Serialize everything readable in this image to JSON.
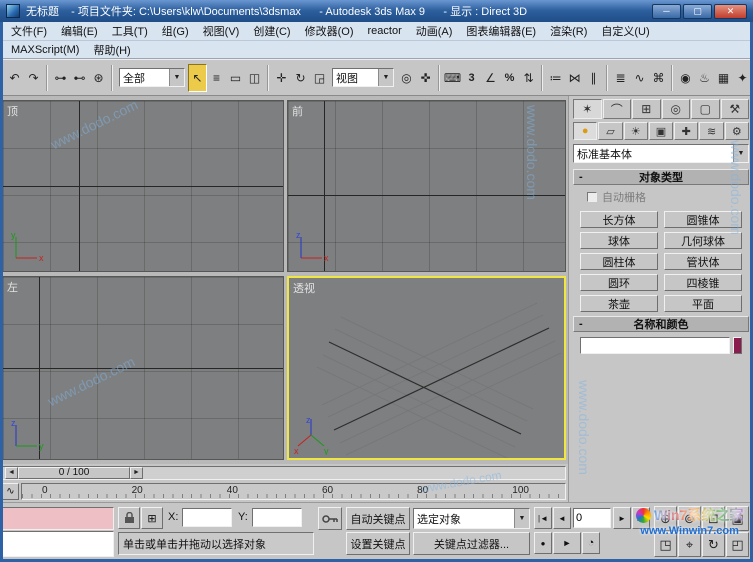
{
  "titlebar": {
    "doc": "无标题",
    "rest": "  - 项目文件夹: C:\\Users\\klw\\Documents\\3dsmax      - Autodesk 3ds Max 9      - 显示 : Direct 3D"
  },
  "menu": {
    "items": [
      "文件(F)",
      "编辑(E)",
      "工具(T)",
      "组(G)",
      "视图(V)",
      "创建(C)",
      "修改器(O)",
      "reactor",
      "动画(A)",
      "图表编辑器(E)",
      "渲染(R)",
      "自定义(U)"
    ],
    "row2": [
      "MAXScript(M)",
      "帮助(H)"
    ]
  },
  "toolbar": {
    "selection_filter": "全部",
    "reference_coord": "视图"
  },
  "icons": {
    "minimize": "─",
    "maximize": "▢",
    "close": "✕",
    "undo": "↶",
    "redo": "↷",
    "link": "⊶",
    "unlink": "⊷",
    "bind": "⊛",
    "select": "↖",
    "select_by_name": "≡",
    "region": "▭",
    "window_crossing": "◫",
    "move": "✛",
    "rotate": "↻",
    "scale": "◲",
    "pivot": "◎",
    "manipulate": "✜",
    "keyboard": "⌨",
    "snap3": "3",
    "angle_snap": "∠",
    "percent_snap": "%",
    "spinner_snap": "⇅",
    "named_sets": "≔",
    "mirror": "⋈",
    "align": "∥",
    "layers": "≣",
    "curve_editor": "∿",
    "schematic": "⌘",
    "material": "◉",
    "render_setup": "♨",
    "render_last": "▦",
    "render": "✦",
    "dd_arrow": "▼",
    "tab_create": "✶",
    "tab_modify": "⌒",
    "tab_hierarchy": "⊞",
    "tab_motion": "◎",
    "tab_display": "▢",
    "tab_utilities": "⚒",
    "cat_geometry": "●",
    "cat_shapes": "▱",
    "cat_lights": "☀",
    "cat_cameras": "▣",
    "cat_helpers": "✚",
    "cat_spacewarps": "≋",
    "cat_systems": "⚙",
    "arrow_left": "◄",
    "arrow_right": "►",
    "go_start": "|◄",
    "prev_frame": "◄",
    "next_frame": "►",
    "go_end": "►|",
    "play": "►",
    "key_mode": "●",
    "time_config": "◔",
    "mini_curve": "∿",
    "abs_mode": "⊞",
    "zoom": "⊕",
    "zoom_all": "⊚",
    "zoom_extents": "⊡",
    "zoom_extents_all": "▣",
    "region_zoom": "◳",
    "pan": "⌖",
    "arc_rotate": "↻",
    "min_max": "◰"
  },
  "viewports": {
    "top_label": "顶",
    "front_label": "前",
    "left_label": "左",
    "persp_label": "透视"
  },
  "command_panel": {
    "category_dropdown": "标准基本体",
    "object_type_rollout": "对象类型",
    "autogrid_label": "自动栅格",
    "object_buttons": [
      "长方体",
      "圆锥体",
      "球体",
      "几何球体",
      "圆柱体",
      "管状体",
      "圆环",
      "四棱锥",
      "茶壶",
      "平面"
    ],
    "name_color_rollout": "名称和颜色",
    "name_color_swatch": "#8a1d4e"
  },
  "timeline": {
    "slider_label": "0 / 100",
    "ticks": [
      "0",
      "20",
      "40",
      "60",
      "80",
      "100"
    ]
  },
  "status": {
    "prompt": "单击或单击并拖动以选择对象",
    "x_label": "X:",
    "y_label": "Y:",
    "auto_key": "自动关键点",
    "set_key": "设置关键点",
    "selected_filter": "选定对象",
    "key_filters": "关键点过滤器...",
    "frame": "0"
  },
  "watermarks": {
    "diagonal": "www.dodo.com",
    "site_name": "Win7系统之家",
    "site_url": "www.Winwin7.com"
  }
}
